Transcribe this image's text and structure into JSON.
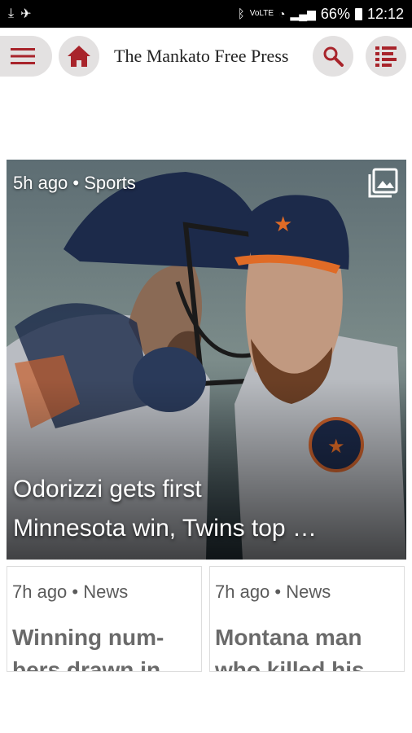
{
  "status_bar": {
    "left_icons": [
      "download-icon",
      "signal-boost-icon"
    ],
    "right_icons": [
      "bluetooth-icon",
      "volte-icon",
      "wifi-icon",
      "cell-signal-icon"
    ],
    "battery": "66%",
    "time": "12:12"
  },
  "header": {
    "brand": "The Mankato Free Press",
    "accent_color": "#a8242b",
    "icons": [
      "menu-icon",
      "home-icon",
      "search-icon",
      "sections-list-icon"
    ]
  },
  "hero": {
    "meta": "5h ago • Sports",
    "title_line1": "Odorizzi gets first",
    "title_line2": "Minnesota win, Twins top …",
    "gallery_icon": "photo-gallery-icon"
  },
  "cards": [
    {
      "meta": "7h ago • News",
      "title": "Winning num- bers drawn in"
    },
    {
      "meta": "7h ago • News",
      "title": "Montana man who killed his"
    }
  ]
}
